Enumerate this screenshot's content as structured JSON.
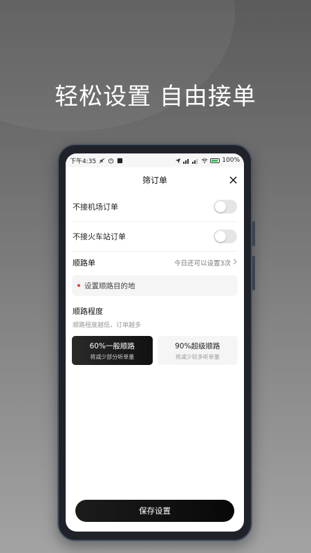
{
  "headline": "轻松设置 自由接单",
  "status_bar": {
    "time": "下午4:35",
    "battery": "100%"
  },
  "sheet": {
    "title": "筛订单",
    "close_icon": "close-icon"
  },
  "filters": {
    "no_airport": {
      "label": "不接机场订单",
      "enabled": false
    },
    "no_station": {
      "label": "不接火车站订单",
      "enabled": false
    }
  },
  "route_order": {
    "label": "顺路单",
    "remaining": "今日还可以设置3次",
    "destination_placeholder": "设置顺路目的地"
  },
  "route_degree": {
    "title": "顺路程度",
    "subtitle": "顺路程度越低，订单越多",
    "options": [
      {
        "title": "60%一般顺路",
        "subtitle": "将减少部分听单量",
        "selected": true
      },
      {
        "title": "90%超级顺路",
        "subtitle": "将减少较多听单量",
        "selected": false
      }
    ]
  },
  "save_button": "保存设置",
  "colors": {
    "accent_dark": "#111111",
    "toggle_off": "#e5e5e5",
    "dot_red": "#e53935",
    "battery_green": "#3cbf5a"
  }
}
